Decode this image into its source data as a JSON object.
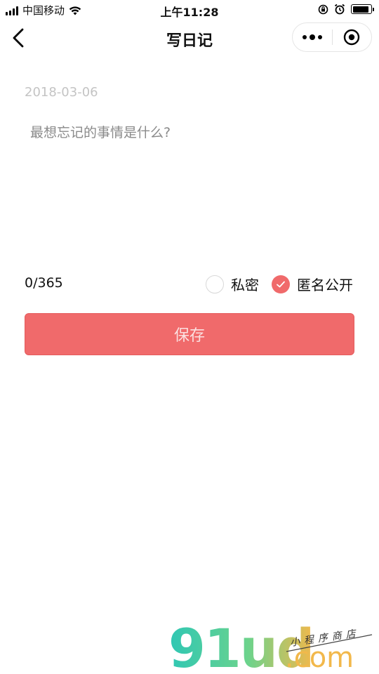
{
  "status_bar": {
    "carrier": "中国移动",
    "time": "上午11:28",
    "battery_level": 0.9
  },
  "nav": {
    "title": "写日记",
    "back_icon": "chevron-left-icon",
    "more_icon": "more-dots-icon",
    "close_icon": "target-circle-icon"
  },
  "editor": {
    "date": "2018-03-06",
    "placeholder": "最想忘记的事情是什么?",
    "value": "",
    "counter": "0/365"
  },
  "visibility": {
    "options": [
      {
        "label": "私密",
        "checked": false
      },
      {
        "label": "匿名公开",
        "checked": true
      }
    ]
  },
  "save_label": "保存",
  "watermark": {
    "brand": "91ud",
    "tagline": "小程序商店",
    "domain": ".com"
  },
  "colors": {
    "accent": "#f06a6b",
    "placeholder": "#8a8a8a",
    "date": "#c4c4c4"
  }
}
